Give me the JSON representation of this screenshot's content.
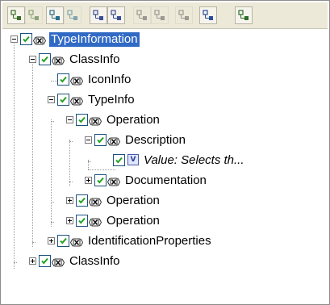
{
  "toolbar": {
    "buttons": [
      {
        "icon": "expand-all-icon",
        "enabled": true
      },
      {
        "icon": "collapse-all-icon",
        "enabled": false
      },
      {
        "icon": "expand-selected-icon",
        "enabled": true
      },
      {
        "icon": "collapse-selected-icon",
        "enabled": false
      },
      {
        "icon": "xml-export-icon",
        "enabled": true
      },
      {
        "icon": "xml-import-icon",
        "enabled": true
      },
      {
        "icon": "copy-icon",
        "enabled": false
      },
      {
        "icon": "paste-icon",
        "enabled": false
      },
      {
        "icon": "cut-icon",
        "enabled": false
      },
      {
        "icon": "edit-value-icon",
        "enabled": true
      },
      {
        "icon": "properties-icon",
        "enabled": true
      }
    ]
  },
  "tree": {
    "nodes": [
      {
        "label": "TypeInformation",
        "level": 0,
        "expander": "minus",
        "checked": true,
        "kind": "element",
        "selected": true
      },
      {
        "label": "ClassInfo",
        "level": 1,
        "expander": "minus",
        "checked": true,
        "kind": "element"
      },
      {
        "label": "IconInfo",
        "level": 2,
        "expander": "none",
        "checked": true,
        "kind": "element"
      },
      {
        "label": "TypeInfo",
        "level": 2,
        "expander": "minus",
        "checked": true,
        "kind": "element"
      },
      {
        "label": "Operation",
        "level": 3,
        "expander": "minus",
        "checked": true,
        "kind": "element"
      },
      {
        "label": "Description",
        "level": 4,
        "expander": "minus",
        "checked": true,
        "kind": "element"
      },
      {
        "label": "Value: Selects th...",
        "level": 5,
        "expander": "none",
        "checked": true,
        "kind": "value"
      },
      {
        "label": "Documentation",
        "level": 4,
        "expander": "plus",
        "checked": true,
        "kind": "element"
      },
      {
        "label": "Operation",
        "level": 3,
        "expander": "plus",
        "checked": true,
        "kind": "element"
      },
      {
        "label": "Operation",
        "level": 3,
        "expander": "plus",
        "checked": true,
        "kind": "element"
      },
      {
        "label": "IdentificationProperties",
        "level": 2,
        "expander": "plus",
        "checked": true,
        "kind": "element"
      },
      {
        "label": "ClassInfo",
        "level": 1,
        "expander": "plus",
        "checked": true,
        "kind": "element"
      }
    ]
  }
}
